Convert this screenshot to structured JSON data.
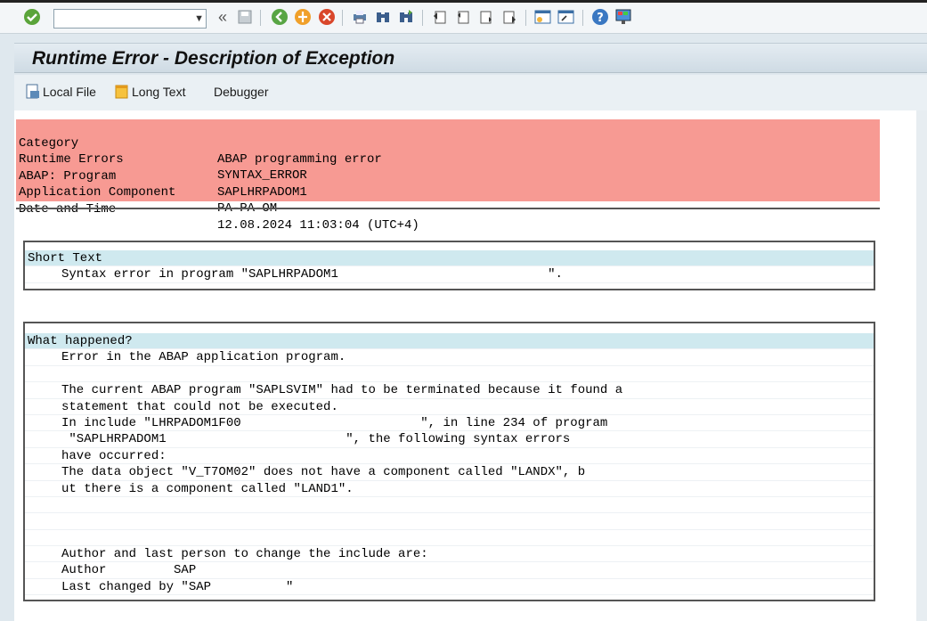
{
  "toolbar": {
    "icons": [
      "enter-icon",
      "save-icon",
      "back-icon",
      "exit-icon",
      "cancel-icon",
      "print-icon",
      "find-icon",
      "find-next-icon",
      "first-page-icon",
      "previous-page-icon",
      "next-page-icon",
      "last-page-icon",
      "new-session-icon",
      "shortcut-icon",
      "help-icon",
      "customize-layout-icon"
    ],
    "command_value": "",
    "collapse_glyph": "«"
  },
  "title": "Runtime Error - Description of Exception",
  "app_toolbar": {
    "local_file": "Local File",
    "long_text": "Long Text",
    "debugger": "Debugger"
  },
  "header": {
    "rows": [
      {
        "key": "Category",
        "value": "ABAP programming error"
      },
      {
        "key": "Runtime Errors",
        "value": "SYNTAX_ERROR"
      },
      {
        "key": "ABAP: Program",
        "value": "SAPLHRPADOM1"
      },
      {
        "key": "Application Component",
        "value": "PA-PA-OM"
      },
      {
        "key": "Date and Time",
        "value": "12.08.2024 11:03:04 (UTC+4)"
      }
    ],
    "color": "#f79a93"
  },
  "short_text": {
    "heading": "Short Text",
    "line1": "Syntax error in program \"SAPLHRPADOM1                            \"."
  },
  "what_happened": {
    "heading": "What happened?",
    "lines": [
      "Error in the ABAP application program.",
      "",
      "The current ABAP program \"SAPLSVIM\" had to be terminated because it found a",
      "statement that could not be executed.",
      "In include \"LHRPADOM1F00                        \", in line 234 of program",
      " \"SAPLHRPADOM1                        \", the following syntax errors",
      "have occurred:",
      "The data object \"V_T7OM02\" does not have a component called \"LANDX\", b",
      "ut there is a component called \"LAND1\".",
      "",
      "",
      "",
      "Author and last person to change the include are:",
      "Author         SAP",
      "Last changed by \"SAP          \""
    ]
  }
}
